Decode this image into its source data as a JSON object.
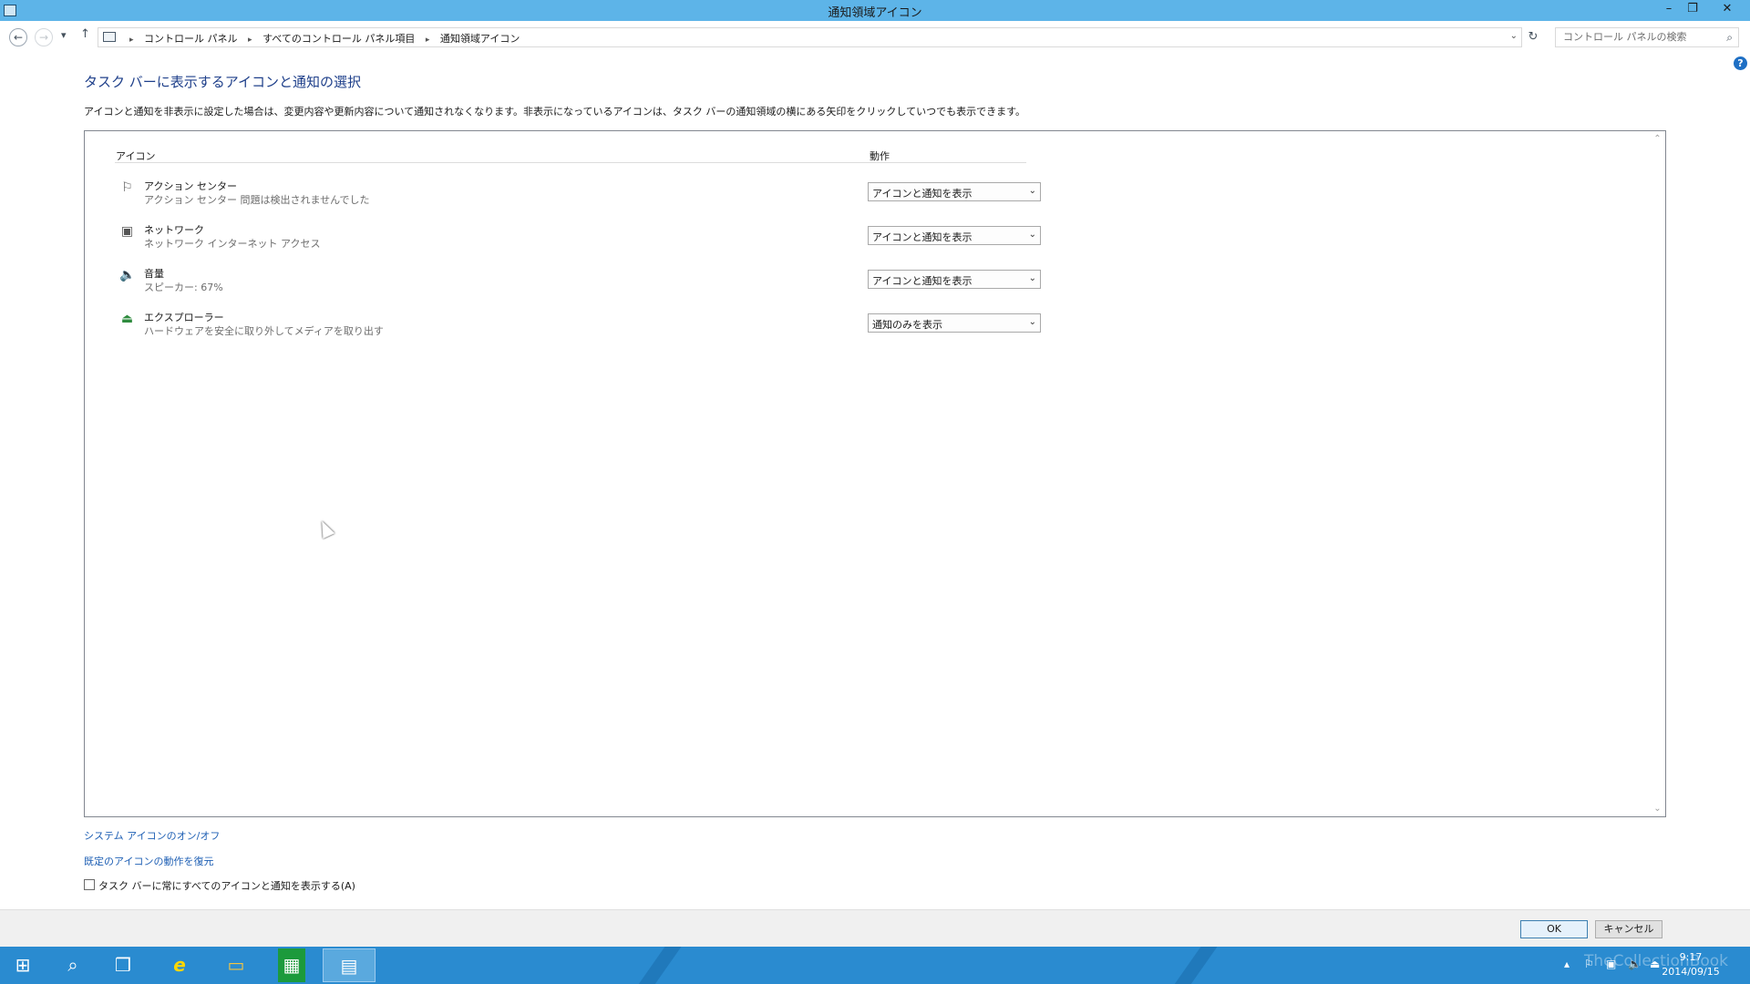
{
  "window": {
    "title": "通知領域アイコン",
    "minimize": "–",
    "restore": "❐",
    "close": "✕"
  },
  "nav": {
    "back": "←",
    "forward": "→",
    "recent": "▾",
    "up": "↑",
    "breadcrumbs": [
      "コントロール パネル",
      "すべてのコントロール パネル項目",
      "通知領域アイコン"
    ],
    "separator": "▸",
    "dropdown": "⌄",
    "refresh": "↻",
    "search_placeholder": "コントロール パネルの検索",
    "search_icon": "⌕"
  },
  "help": "?",
  "main": {
    "title": "タスク バーに表示するアイコンと通知の選択",
    "description": "アイコンと通知を非表示に設定した場合は、変更内容や更新内容について通知されなくなります。非表示になっているアイコンは、タスク バーの通知領域の横にある矢印をクリックしていつでも表示できます。",
    "col_icon": "アイコン",
    "col_behavior": "動作",
    "rows": [
      {
        "icon": "flag-icon",
        "glyph": "⚐",
        "name": "アクション センター",
        "sub": "アクション センター  問題は検出されませんでした",
        "behavior": "アイコンと通知を表示"
      },
      {
        "icon": "network-icon",
        "glyph": "▣",
        "name": "ネットワーク",
        "sub": "ネットワーク インターネット アクセス",
        "behavior": "アイコンと通知を表示"
      },
      {
        "icon": "speaker-icon",
        "glyph": "🔈",
        "name": "音量",
        "sub": "スピーカー: 67%",
        "behavior": "アイコンと通知を表示"
      },
      {
        "icon": "usb-eject-icon",
        "glyph": "⏏",
        "name": "エクスプローラー",
        "sub": "ハードウェアを安全に取り外してメディアを取り出す",
        "behavior": "通知のみを表示"
      }
    ],
    "select_arrow": "⌄",
    "scroll_up": "⌃",
    "scroll_down": "⌄"
  },
  "links": {
    "system_icons": "システム アイコンのオン/オフ",
    "restore_default": "既定のアイコンの動作を復元"
  },
  "checkbox": {
    "label": "タスク バーに常にすべてのアイコンと通知を表示する(A)",
    "checked": false
  },
  "buttons": {
    "ok": "OK",
    "cancel": "キャンセル"
  },
  "taskbar": {
    "start": "⊞",
    "search": "⌕",
    "task_view": "❒",
    "ie": "e",
    "explorer": "▭",
    "store": "▦",
    "control_panel": "▤",
    "time": "9:17",
    "date": "2014/09/15",
    "watermark": "TheCollectionBook",
    "tray_expand": "▴",
    "colors": {
      "taskbar": "#2a8bd0",
      "titlebar": "#5db4e8",
      "link": "#1e5fb4"
    }
  }
}
